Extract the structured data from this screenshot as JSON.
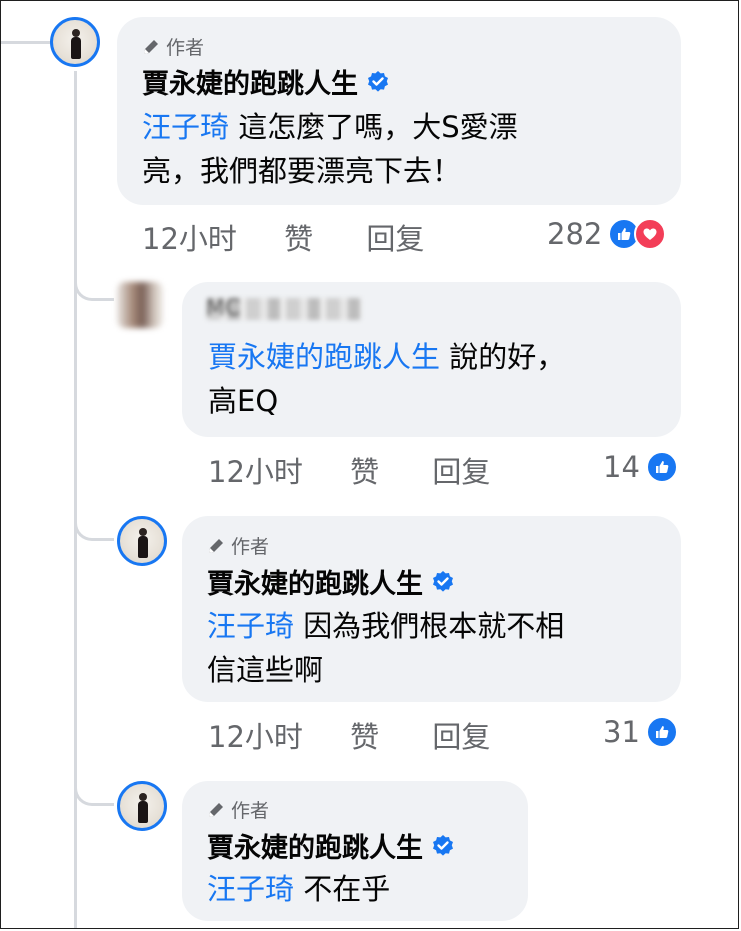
{
  "author_tag": "作者",
  "comments": [
    {
      "name": "賈永婕的跑跳人生",
      "mention": "汪子琦",
      "text_line1": " 這怎麼了嗎，大S愛漂",
      "text_line2": "亮，我們都要漂亮下去！",
      "time": "12小时",
      "like_label": "赞",
      "reply_label": "回复",
      "reaction_count": "282"
    },
    {
      "name_fragment": "MC",
      "mention": "賈永婕的跑跳人生",
      "text_line1": " 說的好，",
      "text_line2": "高EQ",
      "time": "12小时",
      "like_label": "赞",
      "reply_label": "回复",
      "reaction_count": "14"
    },
    {
      "name": "賈永婕的跑跳人生",
      "mention": "汪子琦",
      "text_line1": " 因為我們根本就不相",
      "text_line2": "信這些啊",
      "time": "12小时",
      "like_label": "赞",
      "reply_label": "回复",
      "reaction_count": "31"
    },
    {
      "name": "賈永婕的跑跳人生",
      "mention": "汪子琦",
      "text_line1": " 不在乎"
    }
  ],
  "colors": {
    "accent": "#1877f2",
    "bubble": "#f0f2f5",
    "meta_text": "#65676b",
    "love": "#f33e58"
  }
}
